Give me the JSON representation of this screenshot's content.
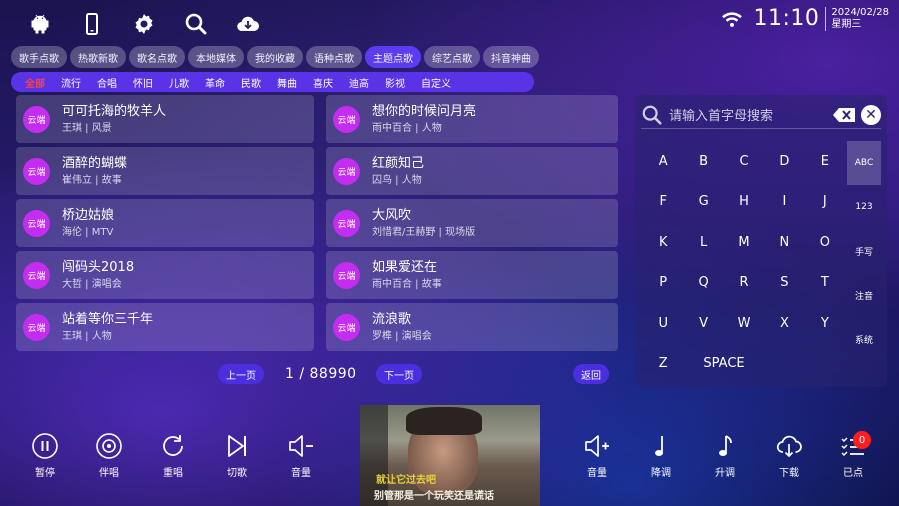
{
  "status": {
    "time": "11:10",
    "date": "2024/02/28",
    "weekday": "星期三"
  },
  "categories": [
    "歌手点歌",
    "热歌新歌",
    "歌名点歌",
    "本地媒体",
    "我的收藏",
    "语种点歌",
    "主题点歌",
    "综艺点歌",
    "抖音神曲"
  ],
  "active_category": "主题点歌",
  "subcategories": [
    "全部",
    "流行",
    "合唱",
    "怀旧",
    "儿歌",
    "革命",
    "民歌",
    "舞曲",
    "喜庆",
    "迪高",
    "影视",
    "自定义"
  ],
  "active_subcategory": "全部",
  "badge_label": "云端",
  "songs": [
    {
      "title": "可可托海的牧羊人",
      "info": "王琪 | 风景"
    },
    {
      "title": "想你的时候问月亮",
      "info": "雨中百合 | 人物"
    },
    {
      "title": "酒醉的蝴蝶",
      "info": "崔伟立 | 故事"
    },
    {
      "title": "红颜知己",
      "info": "囚鸟 | 人物"
    },
    {
      "title": "桥边姑娘",
      "info": "海伦 | MTV"
    },
    {
      "title": "大风吹",
      "info": "刘惜君/王赫野 | 现场版"
    },
    {
      "title": "闯码头2018",
      "info": "大哲 | 演唱会"
    },
    {
      "title": "如果爱还在",
      "info": "雨中百合 | 故事"
    },
    {
      "title": "站着等你三千年",
      "info": "王琪 | 人物"
    },
    {
      "title": "流浪歌",
      "info": "罗榫 | 演唱会"
    }
  ],
  "pager": {
    "prev": "上一页",
    "page": "1 / 88990",
    "next": "下一页",
    "back": "返回"
  },
  "keyboard": {
    "placeholder": "请输入首字母搜索",
    "rows": [
      [
        "A",
        "B",
        "C",
        "D",
        "E"
      ],
      [
        "F",
        "G",
        "H",
        "I",
        "J"
      ],
      [
        "K",
        "L",
        "M",
        "N",
        "O"
      ],
      [
        "P",
        "Q",
        "R",
        "S",
        "T"
      ],
      [
        "U",
        "V",
        "W",
        "X",
        "Y"
      ],
      [
        "Z",
        "SPACE"
      ]
    ],
    "modes": [
      "ABC",
      "123",
      "手写",
      "注音",
      "系统"
    ],
    "active_mode": "ABC"
  },
  "controls_left": [
    {
      "icon": "pause-icon",
      "label": "暂停"
    },
    {
      "icon": "vinyl-icon",
      "label": "伴唱"
    },
    {
      "icon": "replay-icon",
      "label": "重唱"
    },
    {
      "icon": "next-track-icon",
      "label": "切歌"
    },
    {
      "icon": "volume-down-icon",
      "label": "音量"
    }
  ],
  "controls_right": [
    {
      "icon": "volume-up-icon",
      "label": "音量"
    },
    {
      "icon": "note-down-icon",
      "label": "降调"
    },
    {
      "icon": "note-up-icon",
      "label": "升调"
    },
    {
      "icon": "cloud-download-icon",
      "label": "下载"
    },
    {
      "icon": "queue-list-icon",
      "label": "已点"
    }
  ],
  "queue_count": "0",
  "video": {
    "lyric_line1": "就让它过去吧",
    "lyric_line2": "别管那是一个玩笑还是谎话"
  }
}
